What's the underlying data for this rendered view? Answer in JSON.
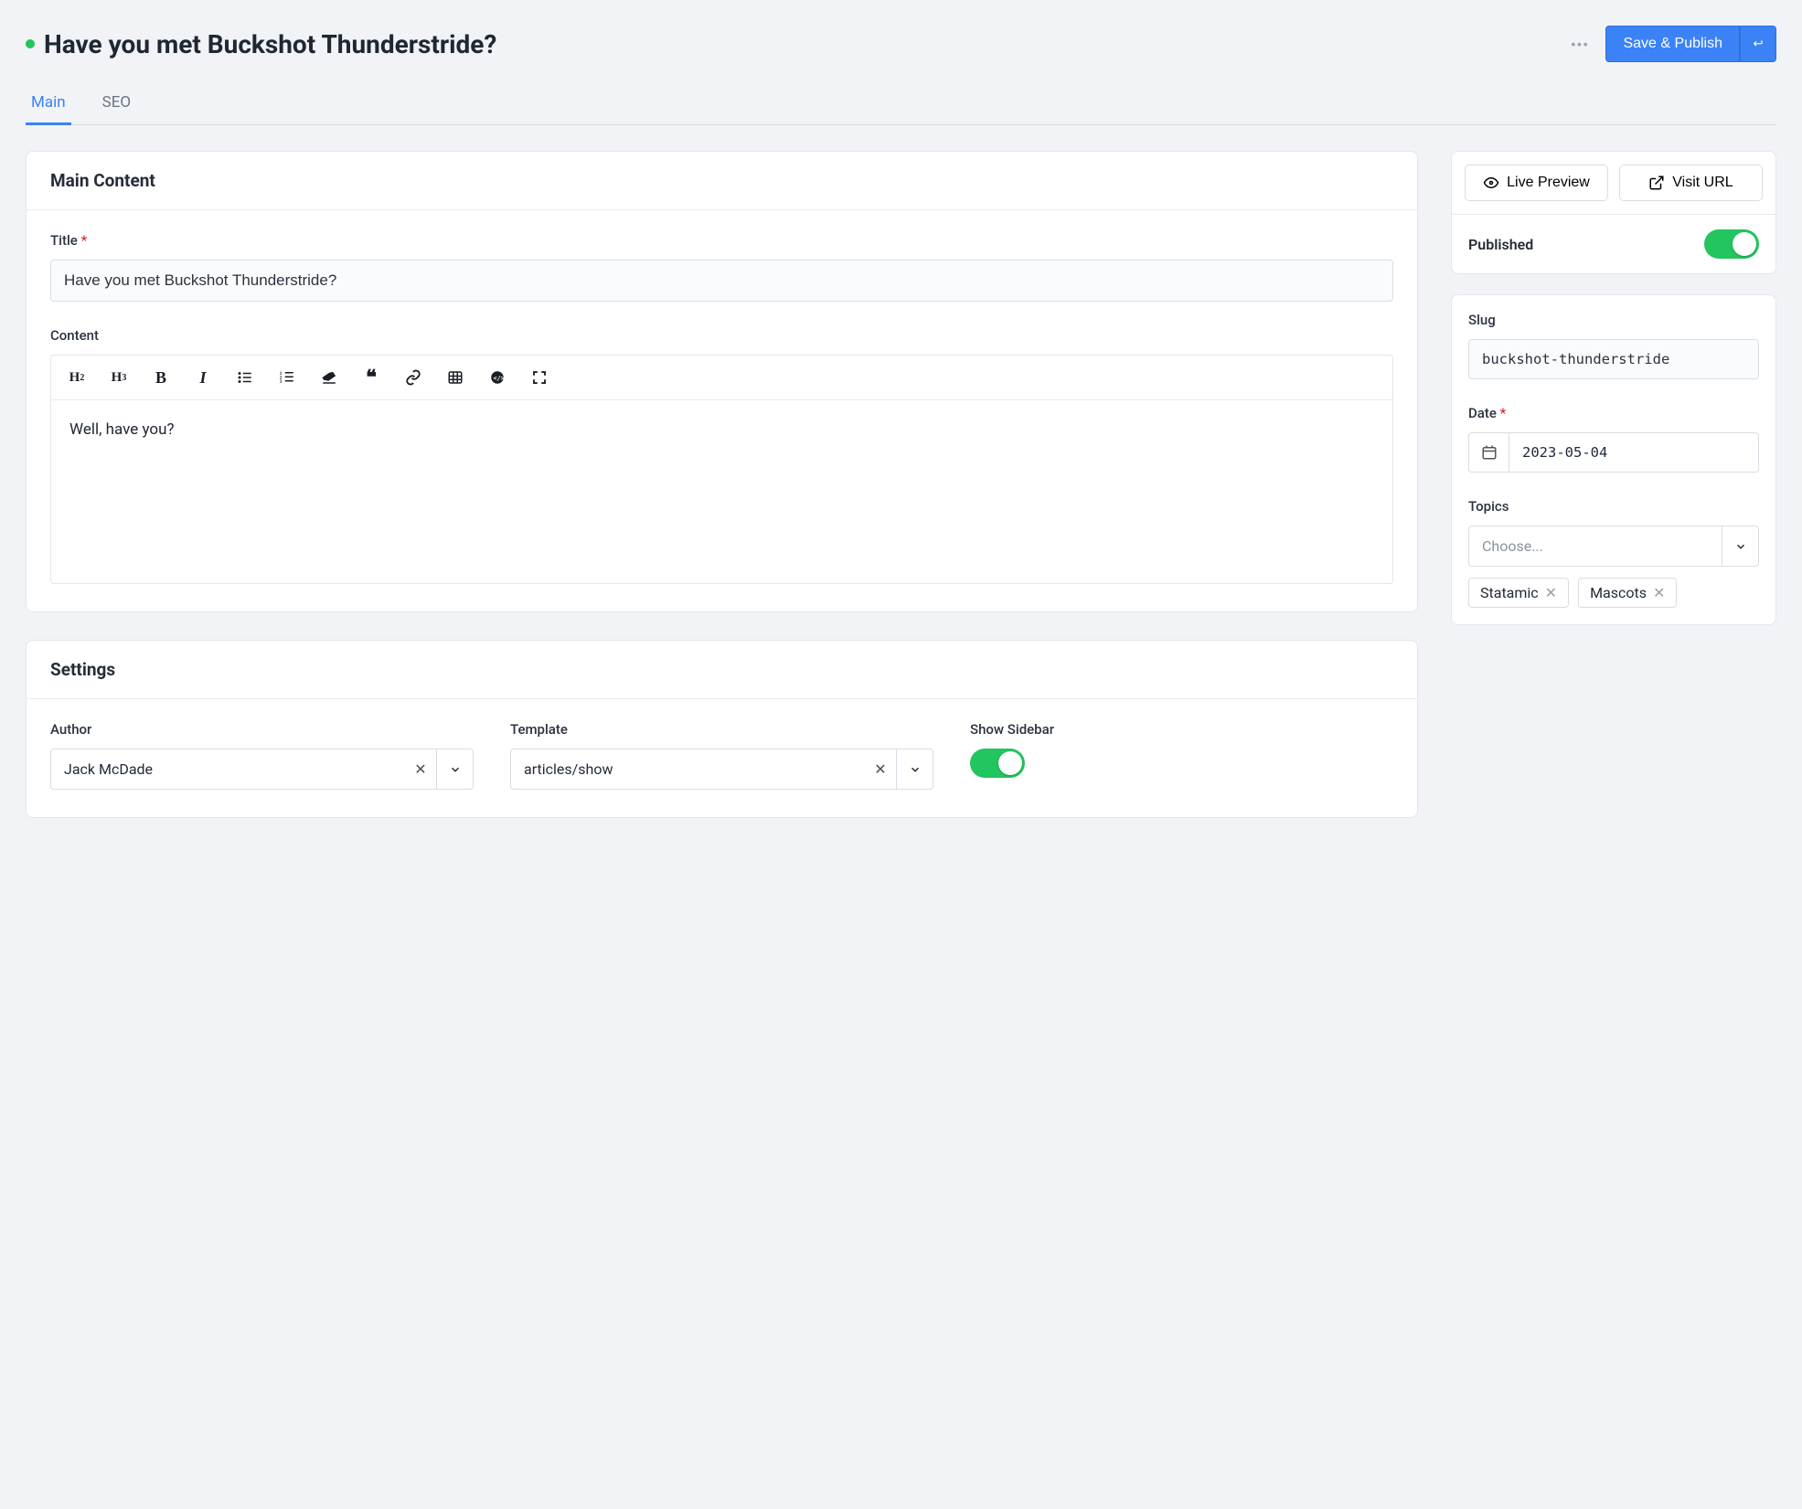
{
  "header": {
    "title": "Have you met Buckshot Thunderstride?",
    "save_label": "Save & Publish"
  },
  "tabs": {
    "main": "Main",
    "seo": "SEO"
  },
  "main": {
    "section_label": "Main Content",
    "title_label": "Title",
    "title_value": "Have you met Buckshot Thunderstride?",
    "content_label": "Content",
    "content_value": "Well, have you?"
  },
  "settings": {
    "section_label": "Settings",
    "author_label": "Author",
    "author_value": "Jack McDade",
    "template_label": "Template",
    "template_value": "articles/show",
    "show_sidebar_label": "Show Sidebar",
    "show_sidebar_on": true
  },
  "sidebar": {
    "live_preview_label": "Live Preview",
    "visit_url_label": "Visit URL",
    "published_label": "Published",
    "published_on": true,
    "slug_label": "Slug",
    "slug_value": "buckshot-thunderstride",
    "date_label": "Date",
    "date_value": "2023-05-04",
    "topics_label": "Topics",
    "topics_placeholder": "Choose...",
    "topics": [
      "Statamic",
      "Mascots"
    ]
  }
}
